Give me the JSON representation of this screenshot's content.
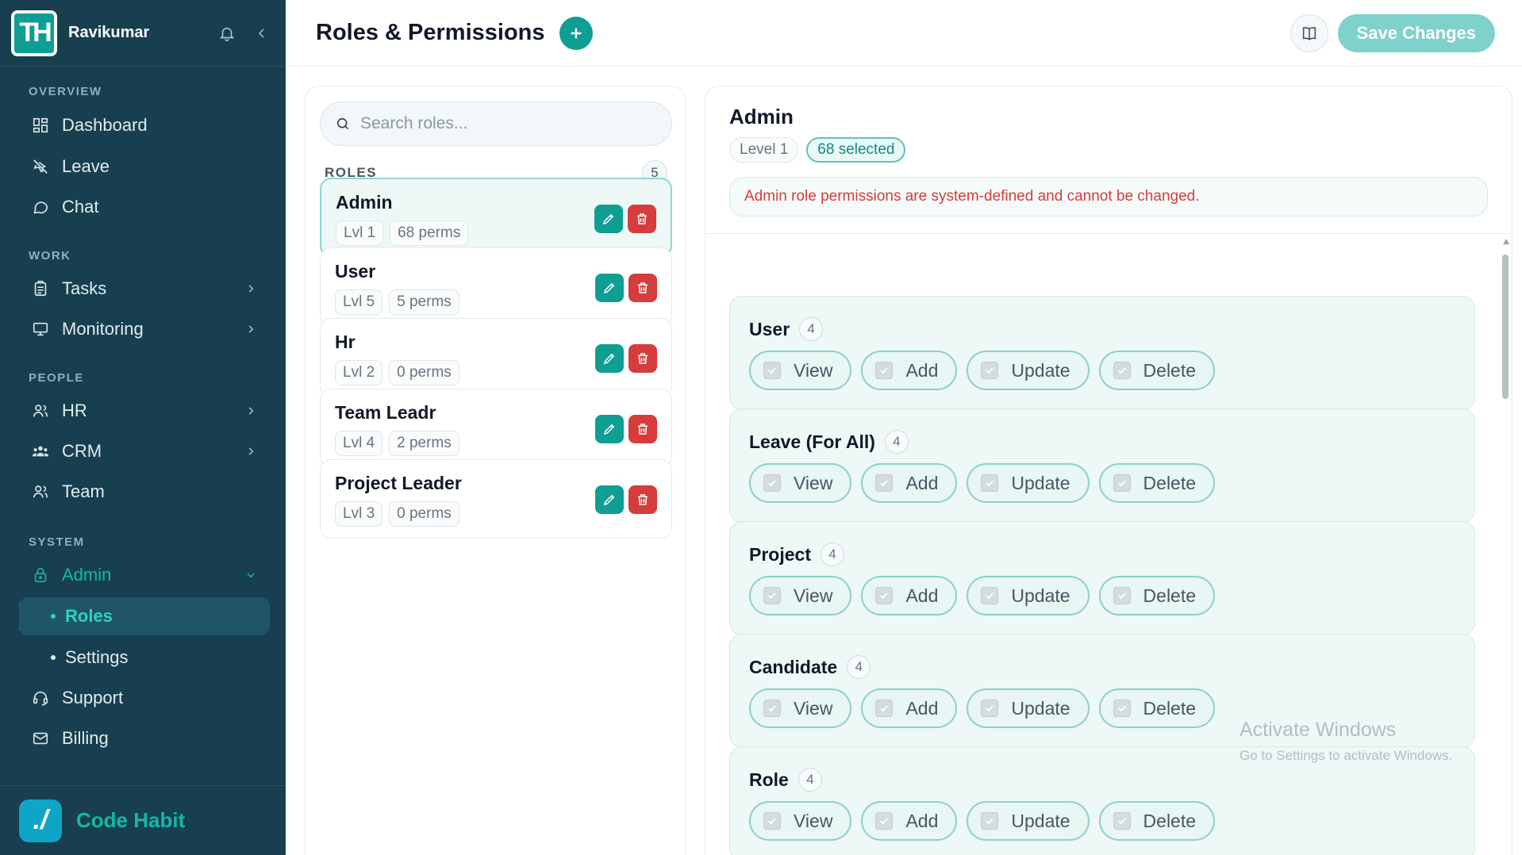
{
  "sidebar": {
    "user_name": "Ravikumar",
    "logo_letters": "TH",
    "sections": {
      "overview": "OVERVIEW",
      "work": "WORK",
      "people": "PEOPLE",
      "system": "SYSTEM"
    },
    "items": {
      "dashboard": "Dashboard",
      "leave": "Leave",
      "chat": "Chat",
      "tasks": "Tasks",
      "monitoring": "Monitoring",
      "hr": "HR",
      "crm": "CRM",
      "team": "Team",
      "admin": "Admin",
      "roles": "Roles",
      "settings": "Settings",
      "support": "Support",
      "billing": "Billing"
    },
    "brand": "Code Habit",
    "brand_mark": "./"
  },
  "header": {
    "title": "Roles & Permissions",
    "add_icon": "plus-icon",
    "docs_icon": "book-icon",
    "save_label": "Save Changes"
  },
  "roles_panel": {
    "search_placeholder": "Search roles...",
    "label": "ROLES",
    "count": "5",
    "roles": [
      {
        "name": "Admin",
        "level": "Lvl 1",
        "perms": "68 perms",
        "selected": true
      },
      {
        "name": "User",
        "level": "Lvl 5",
        "perms": "5 perms",
        "selected": false
      },
      {
        "name": "Hr",
        "level": "Lvl 2",
        "perms": "0 perms",
        "selected": false
      },
      {
        "name": "Team Leadr",
        "level": "Lvl 4",
        "perms": "2 perms",
        "selected": false
      },
      {
        "name": "Project Leader",
        "level": "Lvl 3",
        "perms": "0 perms",
        "selected": false
      }
    ]
  },
  "detail": {
    "title": "Admin",
    "level_badge": "Level 1",
    "selected_badge": "68 selected",
    "notice": "Admin role permissions are system-defined and cannot be changed.",
    "modules": [
      {
        "name": "User",
        "count": "4",
        "perms": [
          "View",
          "Add",
          "Update",
          "Delete"
        ]
      },
      {
        "name": "Leave (For All)",
        "count": "4",
        "perms": [
          "View",
          "Add",
          "Update",
          "Delete"
        ]
      },
      {
        "name": "Project",
        "count": "4",
        "perms": [
          "View",
          "Add",
          "Update",
          "Delete"
        ]
      },
      {
        "name": "Candidate",
        "count": "4",
        "perms": [
          "View",
          "Add",
          "Update",
          "Delete"
        ]
      },
      {
        "name": "Role",
        "count": "4",
        "perms": [
          "View",
          "Add",
          "Update",
          "Delete"
        ]
      }
    ]
  },
  "watermark": {
    "line1": "Activate Windows",
    "line2": "Go to Settings to activate Windows."
  },
  "colors": {
    "sidebar_bg": "#173f4f",
    "accent": "#0f9e93",
    "danger": "#d63c3c",
    "save_button": "#7fd1cb",
    "module_bg": "#eef8f7"
  }
}
